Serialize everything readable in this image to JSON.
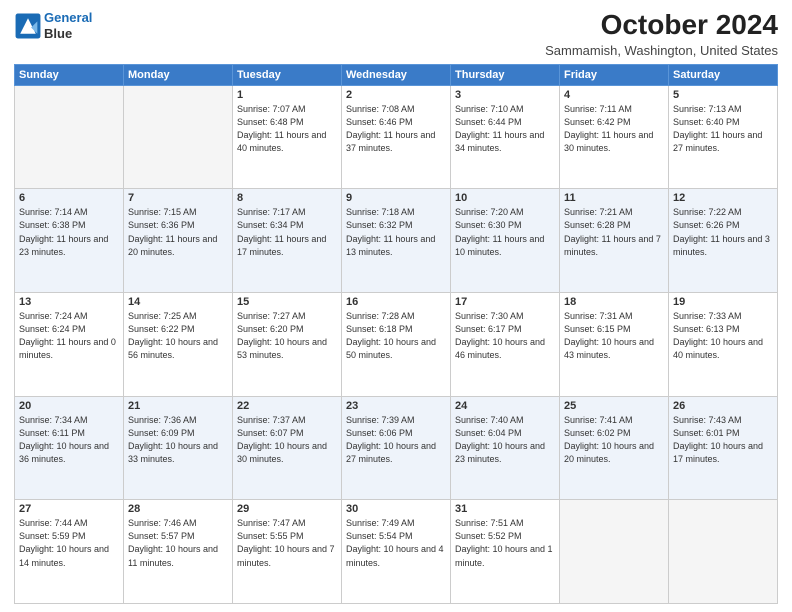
{
  "header": {
    "logo_line1": "General",
    "logo_line2": "Blue",
    "month_title": "October 2024",
    "location": "Sammamish, Washington, United States"
  },
  "weekdays": [
    "Sunday",
    "Monday",
    "Tuesday",
    "Wednesday",
    "Thursday",
    "Friday",
    "Saturday"
  ],
  "weeks": [
    [
      {
        "day": "",
        "sunrise": "",
        "sunset": "",
        "daylight": "",
        "empty": true
      },
      {
        "day": "",
        "sunrise": "",
        "sunset": "",
        "daylight": "",
        "empty": true
      },
      {
        "day": "1",
        "sunrise": "Sunrise: 7:07 AM",
        "sunset": "Sunset: 6:48 PM",
        "daylight": "Daylight: 11 hours and 40 minutes.",
        "empty": false
      },
      {
        "day": "2",
        "sunrise": "Sunrise: 7:08 AM",
        "sunset": "Sunset: 6:46 PM",
        "daylight": "Daylight: 11 hours and 37 minutes.",
        "empty": false
      },
      {
        "day": "3",
        "sunrise": "Sunrise: 7:10 AM",
        "sunset": "Sunset: 6:44 PM",
        "daylight": "Daylight: 11 hours and 34 minutes.",
        "empty": false
      },
      {
        "day": "4",
        "sunrise": "Sunrise: 7:11 AM",
        "sunset": "Sunset: 6:42 PM",
        "daylight": "Daylight: 11 hours and 30 minutes.",
        "empty": false
      },
      {
        "day": "5",
        "sunrise": "Sunrise: 7:13 AM",
        "sunset": "Sunset: 6:40 PM",
        "daylight": "Daylight: 11 hours and 27 minutes.",
        "empty": false
      }
    ],
    [
      {
        "day": "6",
        "sunrise": "Sunrise: 7:14 AM",
        "sunset": "Sunset: 6:38 PM",
        "daylight": "Daylight: 11 hours and 23 minutes.",
        "empty": false
      },
      {
        "day": "7",
        "sunrise": "Sunrise: 7:15 AM",
        "sunset": "Sunset: 6:36 PM",
        "daylight": "Daylight: 11 hours and 20 minutes.",
        "empty": false
      },
      {
        "day": "8",
        "sunrise": "Sunrise: 7:17 AM",
        "sunset": "Sunset: 6:34 PM",
        "daylight": "Daylight: 11 hours and 17 minutes.",
        "empty": false
      },
      {
        "day": "9",
        "sunrise": "Sunrise: 7:18 AM",
        "sunset": "Sunset: 6:32 PM",
        "daylight": "Daylight: 11 hours and 13 minutes.",
        "empty": false
      },
      {
        "day": "10",
        "sunrise": "Sunrise: 7:20 AM",
        "sunset": "Sunset: 6:30 PM",
        "daylight": "Daylight: 11 hours and 10 minutes.",
        "empty": false
      },
      {
        "day": "11",
        "sunrise": "Sunrise: 7:21 AM",
        "sunset": "Sunset: 6:28 PM",
        "daylight": "Daylight: 11 hours and 7 minutes.",
        "empty": false
      },
      {
        "day": "12",
        "sunrise": "Sunrise: 7:22 AM",
        "sunset": "Sunset: 6:26 PM",
        "daylight": "Daylight: 11 hours and 3 minutes.",
        "empty": false
      }
    ],
    [
      {
        "day": "13",
        "sunrise": "Sunrise: 7:24 AM",
        "sunset": "Sunset: 6:24 PM",
        "daylight": "Daylight: 11 hours and 0 minutes.",
        "empty": false
      },
      {
        "day": "14",
        "sunrise": "Sunrise: 7:25 AM",
        "sunset": "Sunset: 6:22 PM",
        "daylight": "Daylight: 10 hours and 56 minutes.",
        "empty": false
      },
      {
        "day": "15",
        "sunrise": "Sunrise: 7:27 AM",
        "sunset": "Sunset: 6:20 PM",
        "daylight": "Daylight: 10 hours and 53 minutes.",
        "empty": false
      },
      {
        "day": "16",
        "sunrise": "Sunrise: 7:28 AM",
        "sunset": "Sunset: 6:18 PM",
        "daylight": "Daylight: 10 hours and 50 minutes.",
        "empty": false
      },
      {
        "day": "17",
        "sunrise": "Sunrise: 7:30 AM",
        "sunset": "Sunset: 6:17 PM",
        "daylight": "Daylight: 10 hours and 46 minutes.",
        "empty": false
      },
      {
        "day": "18",
        "sunrise": "Sunrise: 7:31 AM",
        "sunset": "Sunset: 6:15 PM",
        "daylight": "Daylight: 10 hours and 43 minutes.",
        "empty": false
      },
      {
        "day": "19",
        "sunrise": "Sunrise: 7:33 AM",
        "sunset": "Sunset: 6:13 PM",
        "daylight": "Daylight: 10 hours and 40 minutes.",
        "empty": false
      }
    ],
    [
      {
        "day": "20",
        "sunrise": "Sunrise: 7:34 AM",
        "sunset": "Sunset: 6:11 PM",
        "daylight": "Daylight: 10 hours and 36 minutes.",
        "empty": false
      },
      {
        "day": "21",
        "sunrise": "Sunrise: 7:36 AM",
        "sunset": "Sunset: 6:09 PM",
        "daylight": "Daylight: 10 hours and 33 minutes.",
        "empty": false
      },
      {
        "day": "22",
        "sunrise": "Sunrise: 7:37 AM",
        "sunset": "Sunset: 6:07 PM",
        "daylight": "Daylight: 10 hours and 30 minutes.",
        "empty": false
      },
      {
        "day": "23",
        "sunrise": "Sunrise: 7:39 AM",
        "sunset": "Sunset: 6:06 PM",
        "daylight": "Daylight: 10 hours and 27 minutes.",
        "empty": false
      },
      {
        "day": "24",
        "sunrise": "Sunrise: 7:40 AM",
        "sunset": "Sunset: 6:04 PM",
        "daylight": "Daylight: 10 hours and 23 minutes.",
        "empty": false
      },
      {
        "day": "25",
        "sunrise": "Sunrise: 7:41 AM",
        "sunset": "Sunset: 6:02 PM",
        "daylight": "Daylight: 10 hours and 20 minutes.",
        "empty": false
      },
      {
        "day": "26",
        "sunrise": "Sunrise: 7:43 AM",
        "sunset": "Sunset: 6:01 PM",
        "daylight": "Daylight: 10 hours and 17 minutes.",
        "empty": false
      }
    ],
    [
      {
        "day": "27",
        "sunrise": "Sunrise: 7:44 AM",
        "sunset": "Sunset: 5:59 PM",
        "daylight": "Daylight: 10 hours and 14 minutes.",
        "empty": false
      },
      {
        "day": "28",
        "sunrise": "Sunrise: 7:46 AM",
        "sunset": "Sunset: 5:57 PM",
        "daylight": "Daylight: 10 hours and 11 minutes.",
        "empty": false
      },
      {
        "day": "29",
        "sunrise": "Sunrise: 7:47 AM",
        "sunset": "Sunset: 5:55 PM",
        "daylight": "Daylight: 10 hours and 7 minutes.",
        "empty": false
      },
      {
        "day": "30",
        "sunrise": "Sunrise: 7:49 AM",
        "sunset": "Sunset: 5:54 PM",
        "daylight": "Daylight: 10 hours and 4 minutes.",
        "empty": false
      },
      {
        "day": "31",
        "sunrise": "Sunrise: 7:51 AM",
        "sunset": "Sunset: 5:52 PM",
        "daylight": "Daylight: 10 hours and 1 minute.",
        "empty": false
      },
      {
        "day": "",
        "sunrise": "",
        "sunset": "",
        "daylight": "",
        "empty": true
      },
      {
        "day": "",
        "sunrise": "",
        "sunset": "",
        "daylight": "",
        "empty": true
      }
    ]
  ]
}
